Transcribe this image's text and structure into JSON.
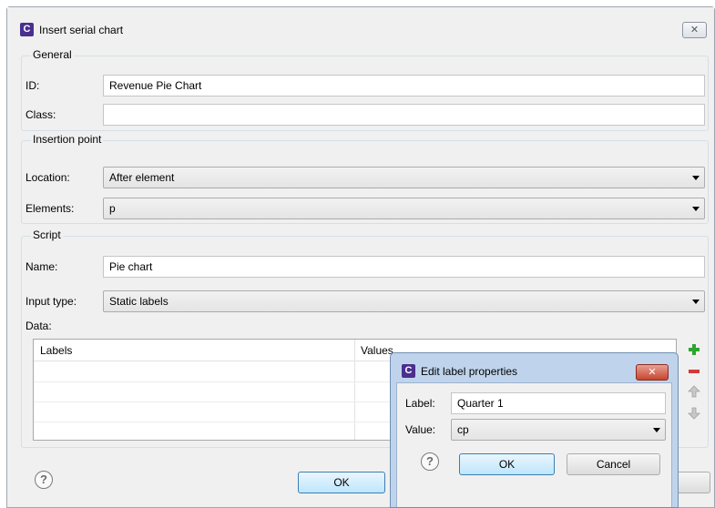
{
  "dialog": {
    "app_icon": "C",
    "title": "Insert serial chart",
    "close_glyph": "✕"
  },
  "general": {
    "legend": "General",
    "id_label": "ID:",
    "id_value": "Revenue Pie Chart",
    "class_label": "Class:",
    "class_value": ""
  },
  "insertion": {
    "legend": "Insertion point",
    "location_label": "Location:",
    "location_value": "After element",
    "elements_label": "Elements:",
    "elements_value": "p"
  },
  "script": {
    "legend": "Script",
    "name_label": "Name:",
    "name_value": "Pie chart",
    "input_type_label": "Input type:",
    "input_type_value": "Static labels",
    "data_label": "Data:",
    "columns": [
      "Labels",
      "Values"
    ]
  },
  "footer": {
    "ok_label": "OK"
  },
  "edit_label_dialog": {
    "app_icon": "C",
    "title": "Edit label properties",
    "close_glyph": "✕",
    "label_label": "Label:",
    "label_value": "Quarter 1",
    "value_label": "Value:",
    "value_value": "cp",
    "ok_label": "OK",
    "cancel_label": "Cancel"
  },
  "icons": {
    "help": "?",
    "colors": {
      "add": "#2fa52f",
      "remove": "#d23a3a",
      "disabled": "#b4b4b4"
    }
  }
}
